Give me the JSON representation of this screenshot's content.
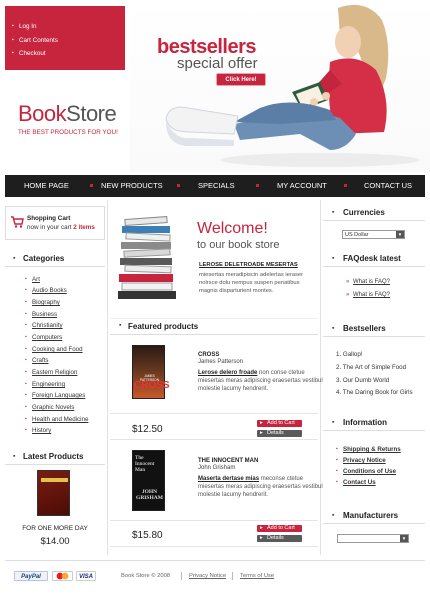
{
  "header": {
    "top_menu": [
      "Log In",
      "Cart Contents",
      "Checkout"
    ],
    "logo_book": "Book",
    "logo_store": "Store",
    "tagline": "THE BEST PRODUCTS FOR YOU!",
    "promo_line1": "bestsellers",
    "promo_line2": "special offer",
    "promo_button": "Click Here!"
  },
  "nav": [
    "HOME PAGE",
    "NEW PRODUCTS",
    "SPECIALS",
    "MY ACCOUNT",
    "CONTACT US"
  ],
  "cart": {
    "title": "Shopping Cart",
    "text_prefix": "now in your cart",
    "count": "2 items"
  },
  "categories": {
    "title": "Categories",
    "items": [
      "Art",
      "Audio Books",
      "Biography",
      "Business",
      "Christianity",
      "Computers",
      "Cooking and Food",
      "Crafts",
      "Eastern Religion",
      "Engineering",
      "Foreign Languages",
      "Graphic Novels",
      "Health and Medicine",
      "History"
    ]
  },
  "latest": {
    "title": "Latest Products",
    "book_title": "FOR ONE MORE DAY",
    "price": "$14.00"
  },
  "welcome": {
    "line1": "Welcome!",
    "line2": "to our book store",
    "link": "LEROSE DELETROADE MESERTAS",
    "text": "miesertas meradipiscin adelertas ieraser nolrsce dolu nempus suspen penatibus magnis disparturient montes."
  },
  "featured": {
    "title": "Featured products",
    "products": [
      {
        "title": "CROSS",
        "author": "James Patterson",
        "desc_bold": "Lerose delero froade",
        "desc": "non conse ctetue miesertas meras adipiscing eraesertas vestibul molestie lacumy hendrerit.",
        "price": "$12.50",
        "add_label": "Add to Cart",
        "details_label": "Details",
        "cover_author": "JAMES PATTERSON",
        "cover_title": "CROSS"
      },
      {
        "title": "THE INNOCENT MAN",
        "author": "John Grisham",
        "desc_bold": "Maserta dertase mias",
        "desc": "meconse ctetue miesertas meras adipiscing eraesertas vestibul molestie lacumy hendrerit.",
        "price": "$15.80",
        "add_label": "Add to Cart",
        "details_label": "Details",
        "cover_title": "The Innocent Man",
        "cover_author": "JOHN GRISHAM"
      }
    ]
  },
  "currencies": {
    "title": "Currencies",
    "selected": "US Dollar"
  },
  "faqdesk": {
    "title": "FAQdesk latest",
    "items": [
      "What is FAQ?",
      "What is FAQ?"
    ]
  },
  "bestsellers": {
    "title": "Bestsellers",
    "items": [
      "1. Gallop!",
      "2. The Art of Simple Food",
      "3. Our Dumb World",
      "4. The Daring Book for Girls"
    ]
  },
  "information": {
    "title": "Information",
    "items": [
      "Shipping & Returns",
      "Privacy Notice",
      "Conditions of Use",
      "Contact Us"
    ]
  },
  "manufacturers": {
    "title": "Manufacturers"
  },
  "footer": {
    "payments": [
      "PayPal",
      "VISA"
    ],
    "copyright": "Book Store © 2008",
    "links": [
      "Privacy Notice",
      "Terms of Use"
    ]
  },
  "colors": {
    "accent": "#c7253e",
    "nav_bg": "#1e1e1e"
  }
}
